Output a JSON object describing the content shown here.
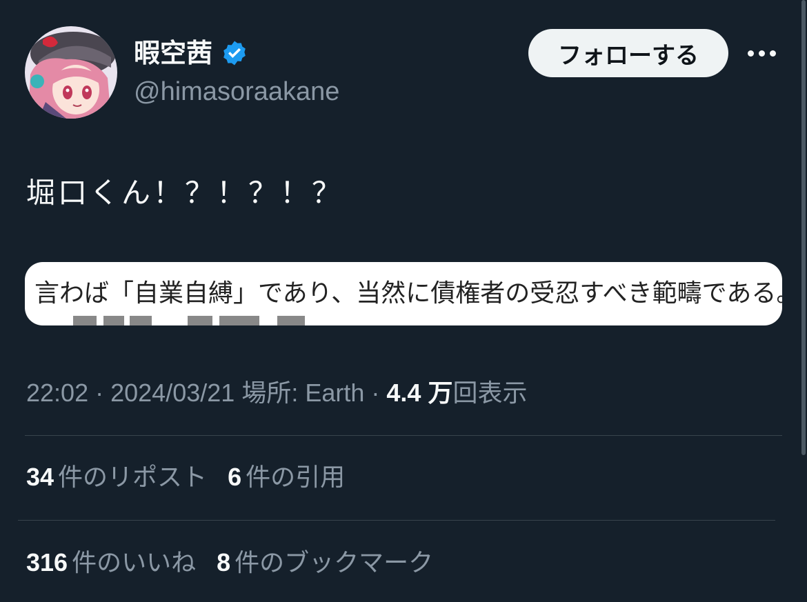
{
  "author": {
    "display_name": "暇空茜",
    "handle": "@himasoraakane",
    "verified": true,
    "avatar_icon": "avatar-image"
  },
  "follow_button_label": "フォローする",
  "more_icon": "more-icon",
  "tweet": {
    "text": "堀口くん！？！？！？",
    "image_text": "言わば「自業自縛」であり、当然に債権者の受忍すべき範疇である。"
  },
  "meta": {
    "time": "22:02",
    "date": "2024/03/21",
    "location": "場所: Earth",
    "views_count": "4.4 万",
    "views_label": "回表示"
  },
  "stats": {
    "reposts_count": "34",
    "reposts_label": "件のリポスト",
    "quotes_count": "6",
    "quotes_label": "件の引用",
    "likes_count": "316",
    "likes_label": "件のいいね",
    "bookmarks_count": "8",
    "bookmarks_label": "件のブックマーク"
  },
  "colors": {
    "background": "#15202b",
    "verified_badge": "#1d9bf0",
    "secondary_text": "#8b98a5"
  }
}
